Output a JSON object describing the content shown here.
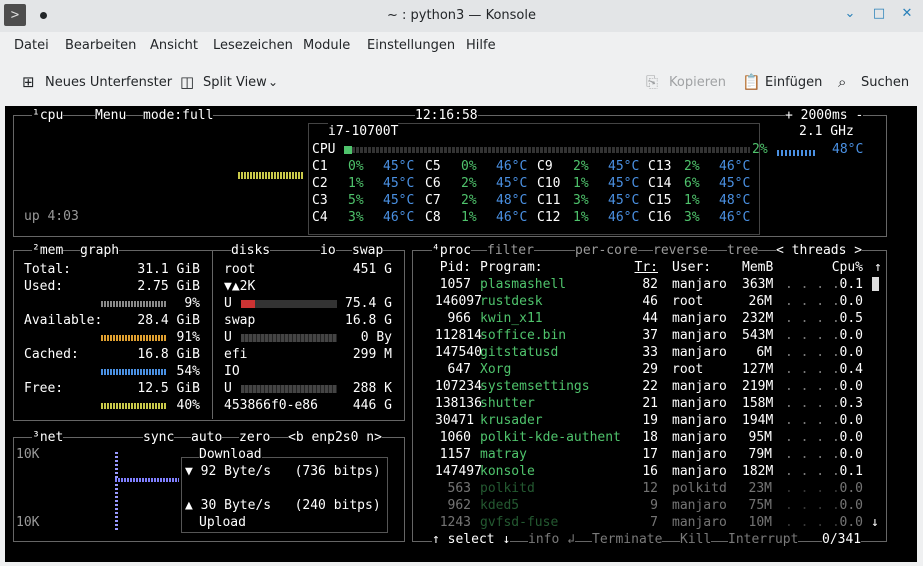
{
  "window": {
    "title": "~ : python3 — Konsole",
    "app_icon": ">",
    "minimize": "⌄",
    "maximize": "□",
    "close": "✕"
  },
  "menu": [
    "Datei",
    "Bearbeiten",
    "Ansicht",
    "Lesezeichen",
    "Module",
    "Einstellungen",
    "Hilfe"
  ],
  "toolbar": {
    "new_tab": "Neues Unterfenster",
    "split_view": "Split View",
    "copy": "Kopieren",
    "paste": "Einfügen",
    "search": "Suchen"
  },
  "cpu": {
    "header_num": "¹",
    "title": "cpu",
    "menu": "Menu",
    "mode": "mode:full",
    "time": "12:16:58",
    "interval": "+ 2000ms -",
    "model": "i7-10700T",
    "freq": "2.1 GHz",
    "total_label": "CPU",
    "total_pct": "2%",
    "total_temp": "48°C",
    "uptime": "up 4:03",
    "cores": [
      [
        "C1",
        "0%",
        "45°C",
        "C5",
        "0%",
        "46°C",
        "C9",
        "2%",
        "45°C",
        "C13",
        "2%",
        "46°C"
      ],
      [
        "C2",
        "1%",
        "45°C",
        "C6",
        "2%",
        "45°C",
        "C10",
        "1%",
        "45°C",
        "C14",
        "6%",
        "45°C"
      ],
      [
        "C3",
        "5%",
        "45°C",
        "C7",
        "2%",
        "48°C",
        "C11",
        "3%",
        "45°C",
        "C15",
        "1%",
        "48°C"
      ],
      [
        "C4",
        "3%",
        "46°C",
        "C8",
        "1%",
        "46°C",
        "C12",
        "1%",
        "46°C",
        "C16",
        "3%",
        "46°C"
      ]
    ]
  },
  "mem": {
    "num": "²",
    "title": "mem",
    "graph": "graph",
    "disks": "disks",
    "io": "io",
    "swap": "swap",
    "rows": [
      [
        "Total:",
        "31.1 GiB"
      ],
      [
        "Used:",
        "2.75 GiB"
      ],
      [
        "",
        "9%"
      ],
      [
        "Available:",
        "28.4 GiB"
      ],
      [
        "",
        "91%"
      ],
      [
        "Cached:",
        "16.8 GiB"
      ],
      [
        "",
        "54%"
      ],
      [
        "Free:",
        "12.5 GiB"
      ],
      [
        "",
        "40%"
      ]
    ],
    "disk_rows": [
      [
        "root",
        "451 G"
      ],
      [
        "▼▲2K",
        ""
      ],
      [
        "U",
        "75.4 G"
      ],
      [
        "swap",
        "16.8 G"
      ],
      [
        "U",
        "0 By"
      ],
      [
        "efi",
        "299 M"
      ],
      [
        "IO",
        ""
      ],
      [
        "U",
        "288 K"
      ],
      [
        "453866f0-e86",
        "446 G"
      ]
    ]
  },
  "net": {
    "num": "³",
    "title": "net",
    "sync": "sync",
    "auto": "auto",
    "zero": "zero",
    "iface": "<b enp2s0 n>",
    "scale_top": "10K",
    "scale_bottom": "10K",
    "download_label": "Download",
    "download_rate": "▼ 92 Byte/s   (736 bitps)",
    "upload_rate": "▲ 30 Byte/s   (240 bitps)",
    "upload_label": "Upload"
  },
  "proc": {
    "num": "⁴",
    "title": "proc",
    "filter": "filter",
    "per_core": "per-core",
    "reverse": "reverse",
    "tree": "tree",
    "threads": "< threads >",
    "columns": [
      "Pid:",
      "Program:",
      "Tr:",
      "User:",
      "MemB",
      "Cpu%"
    ],
    "rows": [
      [
        "1057",
        "plasmashell",
        "82",
        "manjaro",
        "363M",
        "0.1"
      ],
      [
        "146097",
        "rustdesk",
        "46",
        "root",
        "26M",
        "0.0"
      ],
      [
        "966",
        "kwin_x11",
        "44",
        "manjaro",
        "232M",
        "0.5"
      ],
      [
        "112814",
        "soffice.bin",
        "37",
        "manjaro",
        "543M",
        "0.0"
      ],
      [
        "147540",
        "gitstatusd",
        "33",
        "manjaro",
        "6M",
        "0.0"
      ],
      [
        "647",
        "Xorg",
        "29",
        "root",
        "127M",
        "0.4"
      ],
      [
        "107234",
        "systemsettings",
        "22",
        "manjaro",
        "219M",
        "0.0"
      ],
      [
        "138136",
        "shutter",
        "21",
        "manjaro",
        "158M",
        "0.3"
      ],
      [
        "30471",
        "krusader",
        "19",
        "manjaro",
        "194M",
        "0.0"
      ],
      [
        "1060",
        "polkit-kde-authent",
        "18",
        "manjaro",
        "95M",
        "0.0"
      ],
      [
        "1157",
        "matray",
        "17",
        "manjaro",
        "79M",
        "0.0"
      ],
      [
        "147497",
        "konsole",
        "16",
        "manjaro",
        "182M",
        "0.1"
      ],
      [
        "563",
        "polkitd",
        "12",
        "polkitd",
        "23M",
        "0.0"
      ],
      [
        "962",
        "kded5",
        "9",
        "manjaro",
        "75M",
        "0.0"
      ],
      [
        "1243",
        "gvfsd-fuse",
        "7",
        "manjaro",
        "10M",
        "0.0"
      ]
    ],
    "footer": {
      "select": "↑ select ↓",
      "info": "info ↲",
      "terminate": "Terminate",
      "kill": "Kill",
      "interrupt": "Interrupt",
      "count": "0/341"
    }
  },
  "colors": {
    "accent": "#2980b9",
    "term_bg": "#000000",
    "green": "#4fc36c",
    "blue": "#4a90e2"
  }
}
